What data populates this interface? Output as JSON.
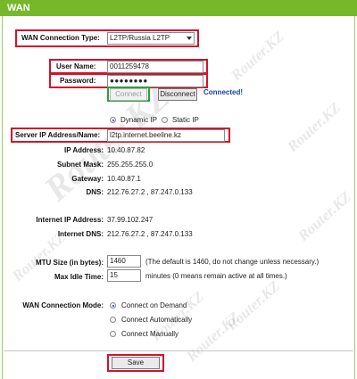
{
  "header": {
    "title": "WAN"
  },
  "wan_connection_type": {
    "label": "WAN Connection Type:",
    "value": "L2TP/Russia L2TP"
  },
  "username": {
    "label": "User Name:",
    "value": "0011259478"
  },
  "password": {
    "label": "Password:",
    "value": "●●●●●●●●"
  },
  "buttons": {
    "connect": "Connect",
    "disconnect": "Disconnect",
    "save": "Save"
  },
  "status": {
    "text": "Connected!",
    "color": "#1a3fa3"
  },
  "ip_mode": {
    "dynamic": "Dynamic IP",
    "static": "Static IP",
    "selected": "Dynamic IP"
  },
  "server": {
    "label": "Server IP Address/Name:",
    "value": "l2tp.internet.beeline.kz"
  },
  "info": {
    "ip_address": {
      "label": "IP Address:",
      "value": "10.40.87.82"
    },
    "subnet_mask": {
      "label": "Subnet Mask:",
      "value": "255.255.255.0"
    },
    "gateway": {
      "label": "Gateway:",
      "value": "10.40.87.1"
    },
    "dns": {
      "label": "DNS:",
      "value": "212.76.27.2 , 87.247.0.133"
    },
    "internet_ip": {
      "label": "Internet IP Address:",
      "value": "37.99.102.247"
    },
    "internet_dns": {
      "label": "Internet DNS:",
      "value": "212.76.27.2 , 87.247.0.133"
    }
  },
  "mtu": {
    "label": "MTU Size (in bytes):",
    "value": "1460",
    "note": "(The default is 1460, do not change unless necessary.)"
  },
  "idle": {
    "label": "Max Idle Time:",
    "value": "15",
    "note": "minutes (0 means remain active at all times.)"
  },
  "connection_mode": {
    "label": "WAN Connection Mode:",
    "options": [
      "Connect on Demand",
      "Connect Automatically",
      "Connect Manually"
    ],
    "selected": "Connect on Demand"
  },
  "watermark": {
    "text": "Router.KZ"
  },
  "colors": {
    "header": "#76b82a",
    "highlight": "#d0142c",
    "connect_box": "#2e9e3e"
  }
}
